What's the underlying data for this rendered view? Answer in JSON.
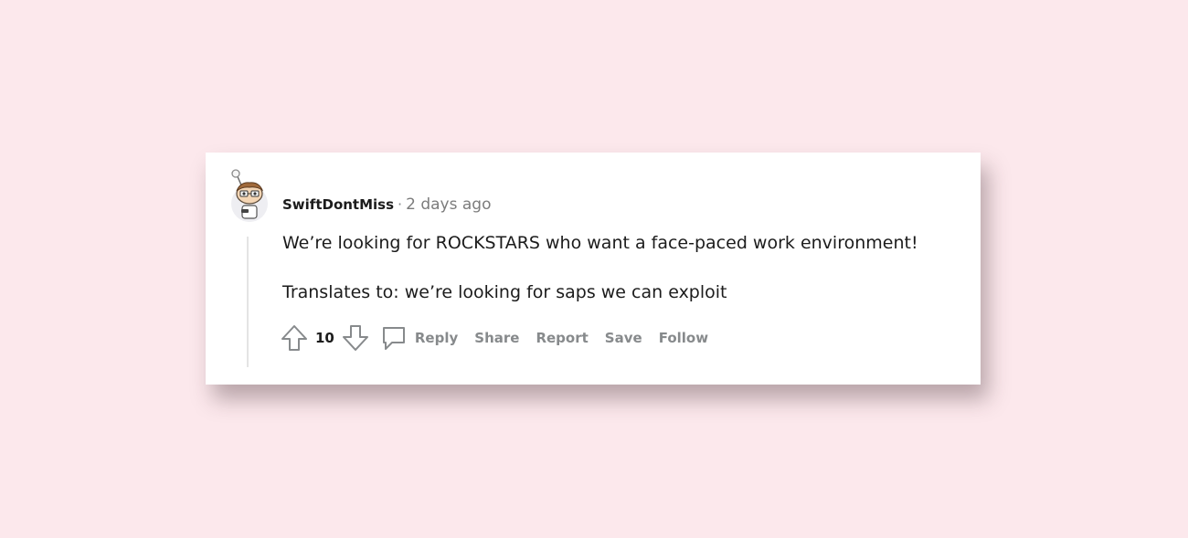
{
  "comment": {
    "username": "SwiftDontMiss",
    "separator": "·",
    "timestamp": "2 days ago",
    "paragraphs": [
      "We’re looking for ROCKSTARS who want a face-paced work environment!",
      "Translates to: we’re looking for saps we can exploit"
    ],
    "vote_count": "10",
    "actions": {
      "reply": "Reply",
      "share": "Share",
      "report": "Report",
      "save": "Save",
      "follow": "Follow"
    },
    "icons": {
      "upvote": "upvote-arrow-icon",
      "downvote": "downvote-arrow-icon",
      "reply": "comment-bubble-icon",
      "avatar": "snoo-avatar"
    }
  },
  "colors": {
    "background": "#fce8ec",
    "card": "#ffffff",
    "text": "#1c1c1c",
    "muted": "#878a8c"
  }
}
